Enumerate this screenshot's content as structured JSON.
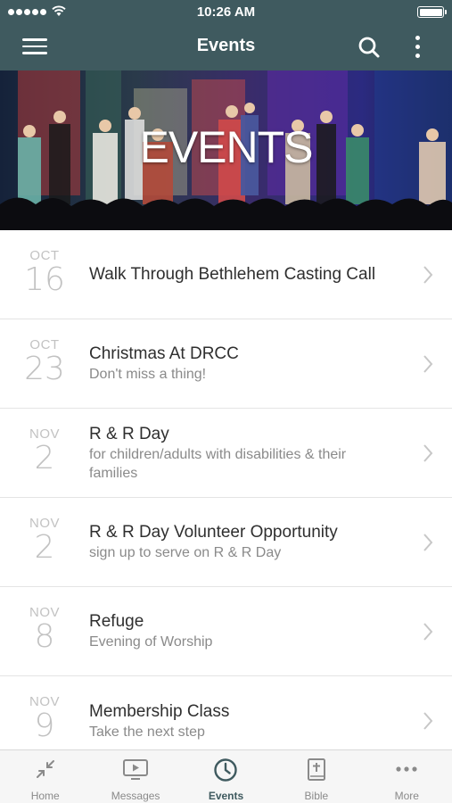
{
  "status_bar": {
    "time": "10:26 AM"
  },
  "nav": {
    "title": "Events"
  },
  "hero": {
    "title": "EVENTS"
  },
  "events": [
    {
      "month": "OCT",
      "day": "16",
      "title": "Walk Through Bethlehem Casting Call",
      "subtitle": ""
    },
    {
      "month": "OCT",
      "day": "23",
      "title": "Christmas At DRCC",
      "subtitle": "Don't miss a thing!"
    },
    {
      "month": "NOV",
      "day": "2",
      "title": "R & R Day",
      "subtitle": "for children/adults with disabilities & their families"
    },
    {
      "month": "NOV",
      "day": "2",
      "title": "R & R Day Volunteer Opportunity",
      "subtitle": "sign up to serve on R & R Day"
    },
    {
      "month": "NOV",
      "day": "8",
      "title": "Refuge",
      "subtitle": "Evening of Worship"
    },
    {
      "month": "NOV",
      "day": "9",
      "title": "Membership Class",
      "subtitle": "Take the next step"
    }
  ],
  "tabs": [
    {
      "label": "Home",
      "icon": "collapse-arrows-icon"
    },
    {
      "label": "Messages",
      "icon": "video-icon"
    },
    {
      "label": "Events",
      "icon": "clock-icon",
      "active": true
    },
    {
      "label": "Bible",
      "icon": "bible-icon"
    },
    {
      "label": "More",
      "icon": "more-dots-icon"
    }
  ],
  "colors": {
    "nav_bg": "#3f5a5f",
    "active_tab": "#3f5a5f",
    "date_text": "#c2c2c2",
    "subtitle_text": "#8a8a8a"
  }
}
